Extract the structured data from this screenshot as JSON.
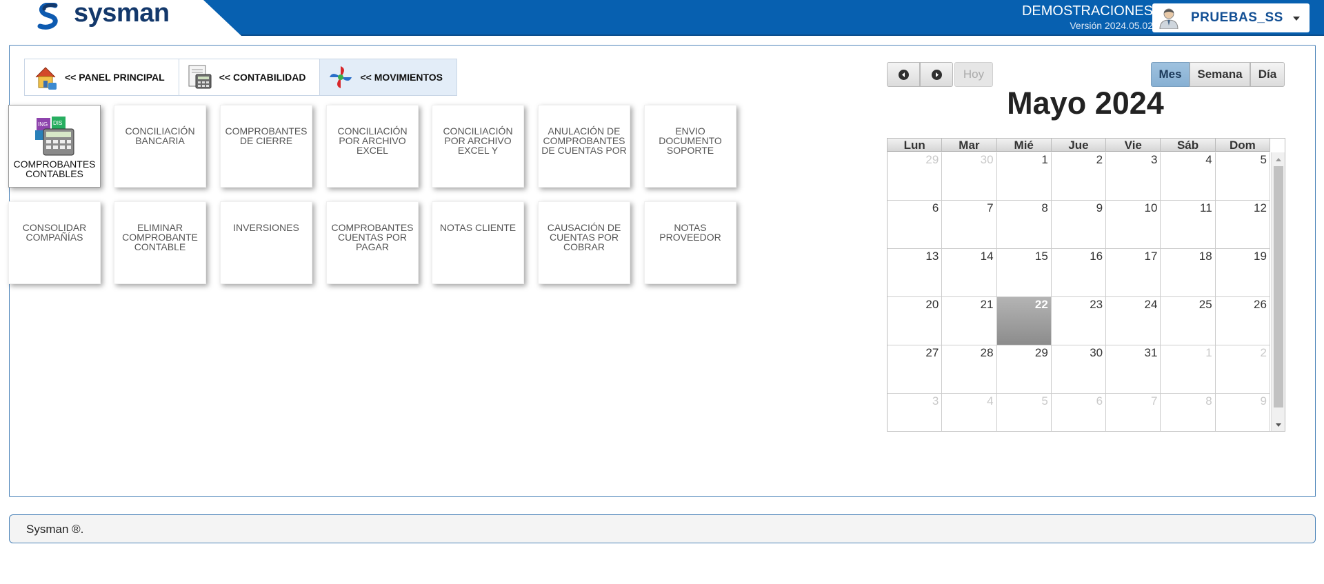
{
  "header": {
    "logo_text": "sysman",
    "org_name": "DEMOSTRACIONES",
    "version": "Versión 2024.05.02",
    "user_name": "PRUEBAS_SS",
    "user_icon": "user-avatar-icon",
    "dropdown_icon": "caret-down-icon",
    "brand_color": "#0760b0"
  },
  "breadcrumb": [
    {
      "label": "<< PANEL PRINCIPAL",
      "icon": "house-icon"
    },
    {
      "label": "<< CONTABILIDAD",
      "icon": "calculator-icon"
    },
    {
      "label": "<< MOVIMIENTOS",
      "icon": "pinwheel-icon"
    }
  ],
  "tiles": [
    {
      "label": "COMPROBANTES CONTABLES",
      "icon": "accounting-calculator-icon"
    },
    {
      "label": "CONCILIACIÓN BANCARIA"
    },
    {
      "label": "COMPROBANTES DE CIERRE"
    },
    {
      "label": "CONCILIACIÓN POR ARCHIVO EXCEL"
    },
    {
      "label": "CONCILIACIÓN POR ARCHIVO EXCEL Y"
    },
    {
      "label": "ANULACIÓN DE COMPROBANTES DE CUENTAS POR"
    },
    {
      "label": "ENVIO DOCUMENTO SOPORTE"
    },
    {
      "label": "CONSOLIDAR COMPAÑÍAS"
    },
    {
      "label": "ELIMINAR COMPROBANTE CONTABLE"
    },
    {
      "label": "INVERSIONES"
    },
    {
      "label": "COMPROBANTES CUENTAS POR PAGAR"
    },
    {
      "label": "NOTAS CLIENTE"
    },
    {
      "label": "CAUSACIÓN DE CUENTAS POR COBRAR"
    },
    {
      "label": "NOTAS PROVEEDOR"
    }
  ],
  "calendar": {
    "title": "Mayo 2024",
    "today_label": "Hoy",
    "prev_icon": "prev-arrow-icon",
    "next_icon": "next-arrow-icon",
    "views": {
      "month": "Mes",
      "week": "Semana",
      "day": "Día"
    },
    "selected_view": "Mes",
    "weekdays": [
      "Lun",
      "Mar",
      "Mié",
      "Jue",
      "Vie",
      "Sáb",
      "Dom"
    ],
    "weeks": [
      [
        "29",
        "30",
        "1",
        "2",
        "3",
        "4",
        "5"
      ],
      [
        "6",
        "7",
        "8",
        "9",
        "10",
        "11",
        "12"
      ],
      [
        "13",
        "14",
        "15",
        "16",
        "17",
        "18",
        "19"
      ],
      [
        "20",
        "21",
        "22",
        "23",
        "24",
        "25",
        "26"
      ],
      [
        "27",
        "28",
        "29",
        "30",
        "31",
        "1",
        "2"
      ],
      [
        "3",
        "4",
        "5",
        "6",
        "7",
        "8",
        "9"
      ]
    ],
    "today": "22"
  },
  "footer": {
    "text": "Sysman ®."
  }
}
